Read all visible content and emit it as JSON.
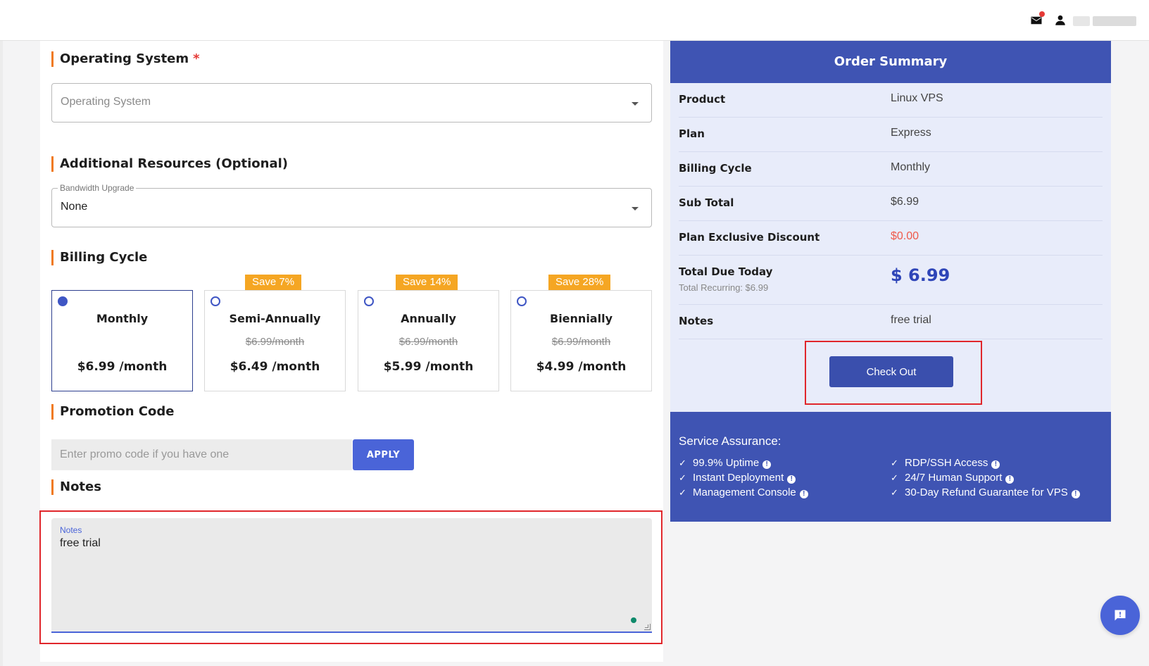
{
  "header": {
    "mail_icon": "mail-icon",
    "user_icon": "user-icon"
  },
  "sections": {
    "os_title": "Operating System",
    "os_required": "*",
    "os_placeholder": "Operating System",
    "resources_title": "Additional Resources (Optional)",
    "bandwidth_label": "Bandwidth Upgrade",
    "bandwidth_value": "None",
    "billing_title": "Billing Cycle",
    "promo_title": "Promotion Code",
    "promo_placeholder": "Enter promo code if you have one",
    "apply_label": "APPLY",
    "notes_title": "Notes",
    "notes_label": "Notes",
    "notes_value": "free trial"
  },
  "billing_options": [
    {
      "name": "Monthly",
      "badge": "",
      "original": "",
      "price": "$6.99 /month",
      "selected": true
    },
    {
      "name": "Semi-Annually",
      "badge": "Save 7%",
      "original": "$6.99/month",
      "price": "$6.49 /month",
      "selected": false
    },
    {
      "name": "Annually",
      "badge": "Save 14%",
      "original": "$6.99/month",
      "price": "$5.99 /month",
      "selected": false
    },
    {
      "name": "Biennially",
      "badge": "Save 28%",
      "original": "$6.99/month",
      "price": "$4.99 /month",
      "selected": false
    }
  ],
  "summary": {
    "title": "Order Summary",
    "rows": [
      {
        "label": "Product",
        "value": "Linux VPS"
      },
      {
        "label": "Plan",
        "value": "Express"
      },
      {
        "label": "Billing Cycle",
        "value": "Monthly"
      },
      {
        "label": "Sub Total",
        "value": "$6.99"
      },
      {
        "label": "Plan Exclusive Discount",
        "value": "$0.00"
      },
      {
        "label": "Total Due Today",
        "value": "$ 6.99",
        "sub": "Total Recurring: $6.99"
      },
      {
        "label": "Notes",
        "value": "free trial"
      }
    ],
    "checkout_label": "Check Out"
  },
  "assurance": {
    "title": "Service Assurance:",
    "items": [
      "99.9% Uptime",
      "Instant Deployment",
      "Management Console",
      "RDP/SSH Access",
      "24/7 Human Support",
      "30-Day Refund Guarantee for VPS"
    ]
  },
  "colors": {
    "accent": "#3f54b3",
    "button": "#4a64d8",
    "orange": "#f07a1f",
    "badge": "#f5a623",
    "discount": "#ef5a4a",
    "highlight": "#e0262b"
  },
  "chat_icon": "chat-icon"
}
